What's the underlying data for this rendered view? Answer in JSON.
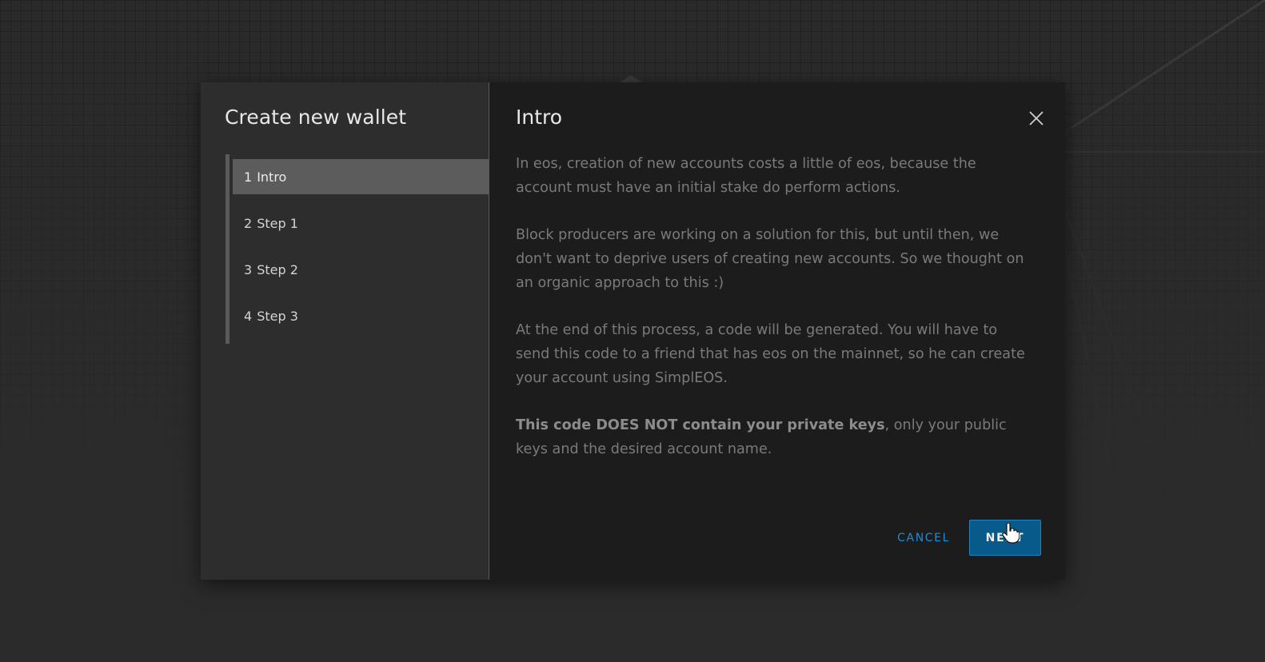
{
  "sidebar": {
    "title": "Create new wallet",
    "steps": [
      {
        "num": "1",
        "label": "Intro"
      },
      {
        "num": "2",
        "label": "Step 1"
      },
      {
        "num": "3",
        "label": "Step 2"
      },
      {
        "num": "4",
        "label": "Step 3"
      }
    ],
    "active_step": 0
  },
  "main": {
    "title": "Intro",
    "paragraphs": {
      "p1": "In eos, creation of new accounts costs a little of eos, because the account must have an initial stake do perform actions.",
      "p2": "Block producers are working on a solution for this, but until then, we don't want to deprive users of creating new accounts. So we thought on an organic approach to this :)",
      "p3": "At the end of this process, a code will be generated. You will have to send this code to a friend that has eos on the mainnet, so he can create your account using SimplEOS.",
      "p4_bold": "This code DOES NOT contain your private keys",
      "p4_rest": ", only your public keys and the desired account name."
    },
    "actions": {
      "cancel_label": "CANCEL",
      "next_label": "NEXT"
    }
  },
  "icons": {
    "close": "close-icon",
    "cursor": "hand-pointer-icon"
  },
  "colors": {
    "accent": "#1a8cd8",
    "primary_button": "#075a8a",
    "active_step": "#5c5c5c"
  }
}
